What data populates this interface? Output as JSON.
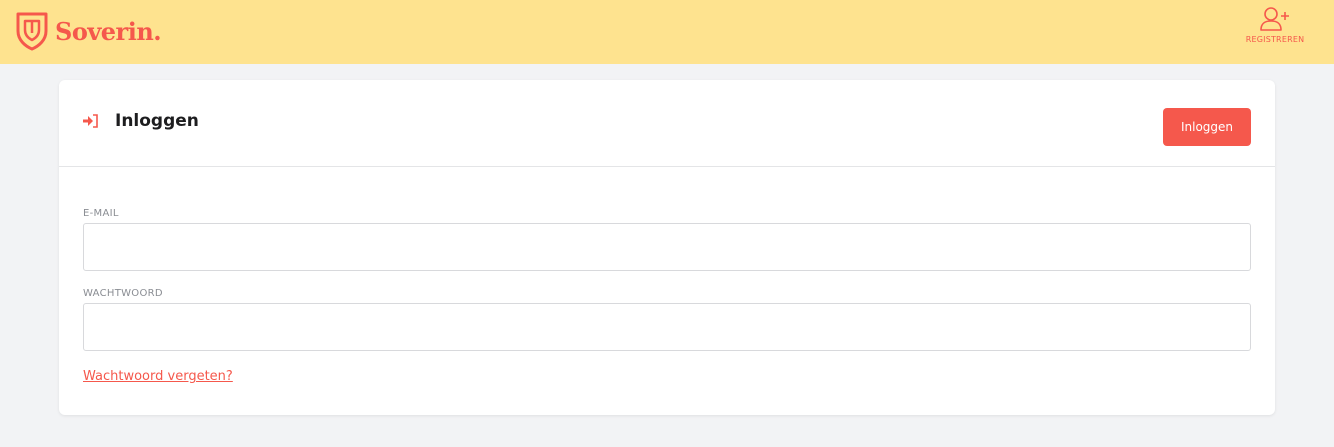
{
  "header": {
    "brand": "Soverin.",
    "register_label": "REGISTREREN",
    "background_color": "#fee38f",
    "accent_color": "#f5584c"
  },
  "login_card": {
    "title": "Inloggen",
    "submit_label": "Inloggen",
    "fields": [
      {
        "label": "E-MAIL",
        "value": "",
        "placeholder": ""
      },
      {
        "label": "WACHTWOORD",
        "value": "",
        "placeholder": ""
      }
    ],
    "forgot_link": "Wachtwoord vergeten?"
  },
  "icons": {
    "logo": "shield-logo-icon",
    "register": "user-plus-icon",
    "login": "sign-in-icon"
  }
}
